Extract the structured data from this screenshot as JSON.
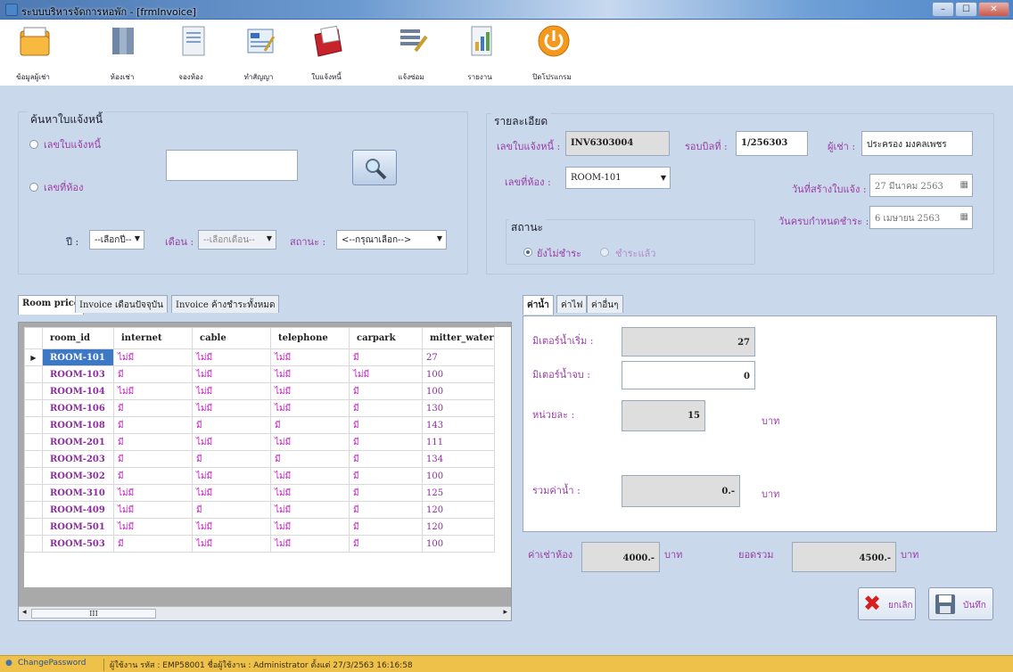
{
  "window": {
    "title": "ระบบบริหารจัดการหอพัก - [frmInvoice]",
    "min": "–",
    "max": "☐",
    "close": "✕"
  },
  "toolbar": [
    {
      "label": "ข้อมูลผู้เช่า",
      "icon": "folder-icon"
    },
    {
      "label": "ห้องเช่า",
      "icon": "books-icon"
    },
    {
      "label": "จองห้อง",
      "icon": "document-icon"
    },
    {
      "label": "ทำสัญญา",
      "icon": "contract-icon"
    },
    {
      "label": "ใบแจ้งหนี้",
      "icon": "invoice-icon"
    },
    {
      "label": "แจ้งซ่อม",
      "icon": "repair-icon"
    },
    {
      "label": "รายงาน",
      "icon": "report-icon"
    },
    {
      "label": "ปิดโปรแกรม",
      "icon": "power-icon"
    }
  ],
  "search": {
    "title": "ค้นหาใบแจ้งหนี้",
    "radio_invoice": "เลขใบแจ้งหนี้",
    "radio_room": "เลขที่ห้อง",
    "input_value": "",
    "year_label": "ปี :",
    "year_value": "--เลือกปี--",
    "month_label": "เดือน :",
    "month_value": "--เลือกเดือน--",
    "status_label": "สถานะ :",
    "status_value": "<--กรุณาเลือก-->"
  },
  "detail": {
    "title": "รายละเอียด",
    "invoice_no_label": "เลขใบแจ้งหนี้ :",
    "invoice_no": "INV6303004",
    "cycle_label": "รอบบิลที่ :",
    "cycle": "1/256303",
    "tenant_label": "ผู้เช่า :",
    "tenant": "ประครอง มงคลเพชร",
    "room_label": "เลขที่ห้อง :",
    "room": "ROOM-101",
    "create_date_label": "วันที่สร้างใบแจ้ง :",
    "create_date": "27  มีนาคม    2563",
    "due_date_label": "วันครบกำหนดชำระ :",
    "due_date": "6  เมษายน    2563",
    "status_group": "สถานะ",
    "status_unpaid": "ยังไม่ชำระ",
    "status_paid": "ชำระแล้ว"
  },
  "left_tabs": [
    "Room price",
    "Invoice เดือนปัจจุบัน",
    "Invoice ค้างชำระทั้งหมด"
  ],
  "grid": {
    "columns": [
      "room_id",
      "internet",
      "cable",
      "telephone",
      "carpark",
      "mitter_water"
    ],
    "rows": [
      [
        "ROOM-101",
        "ไม่มี",
        "ไม่มี",
        "ไม่มี",
        "มี",
        "27"
      ],
      [
        "ROOM-103",
        "มี",
        "ไม่มี",
        "ไม่มี",
        "ไม่มี",
        "100"
      ],
      [
        "ROOM-104",
        "ไม่มี",
        "ไม่มี",
        "ไม่มี",
        "มี",
        "100"
      ],
      [
        "ROOM-106",
        "มี",
        "ไม่มี",
        "ไม่มี",
        "มี",
        "130"
      ],
      [
        "ROOM-108",
        "มี",
        "มี",
        "มี",
        "มี",
        "143"
      ],
      [
        "ROOM-201",
        "มี",
        "ไม่มี",
        "ไม่มี",
        "มี",
        "111"
      ],
      [
        "ROOM-203",
        "มี",
        "มี",
        "มี",
        "มี",
        "134"
      ],
      [
        "ROOM-302",
        "มี",
        "ไม่มี",
        "ไม่มี",
        "มี",
        "100"
      ],
      [
        "ROOM-310",
        "ไม่มี",
        "ไม่มี",
        "ไม่มี",
        "มี",
        "125"
      ],
      [
        "ROOM-409",
        "ไม่มี",
        "มี",
        "ไม่มี",
        "มี",
        "120"
      ],
      [
        "ROOM-501",
        "ไม่มี",
        "ไม่มี",
        "ไม่มี",
        "มี",
        "120"
      ],
      [
        "ROOM-503",
        "มี",
        "ไม่มี",
        "ไม่มี",
        "มี",
        "100"
      ]
    ],
    "hscroll_thumb": "III"
  },
  "right_tabs": [
    "ค่าน้ำ",
    "ค่าไฟ",
    "ค่าอื่นๆ"
  ],
  "water": {
    "start_label": "มิเตอร์น้ำเริ่ม :",
    "start_value": "27",
    "end_label": "มิเตอร์น้ำจบ :",
    "end_value": "0",
    "unit_label": "หน่วยละ :",
    "unit_value": "15",
    "unit_suffix": "บาท",
    "total_label": "รวมค่าน้ำ :",
    "total_value": "0.-",
    "total_suffix": "บาท"
  },
  "summary": {
    "rent_label": "ค่าเช่าห้อง",
    "rent_value": "4000.-",
    "rent_suffix": "บาท",
    "total_label": "ยอดรวม",
    "total_value": "4500.-",
    "total_suffix": "บาท"
  },
  "buttons": {
    "cancel": "ยกเลิก",
    "save": "บันทึก"
  },
  "status_bar": {
    "change_password": "ChangePassword",
    "info": "ผู้ใช้งาน รหัส : EMP58001  ชื่อผู้ใช้งาน : Administrator  ตั้งแต่  27/3/2563 16:16:58"
  }
}
